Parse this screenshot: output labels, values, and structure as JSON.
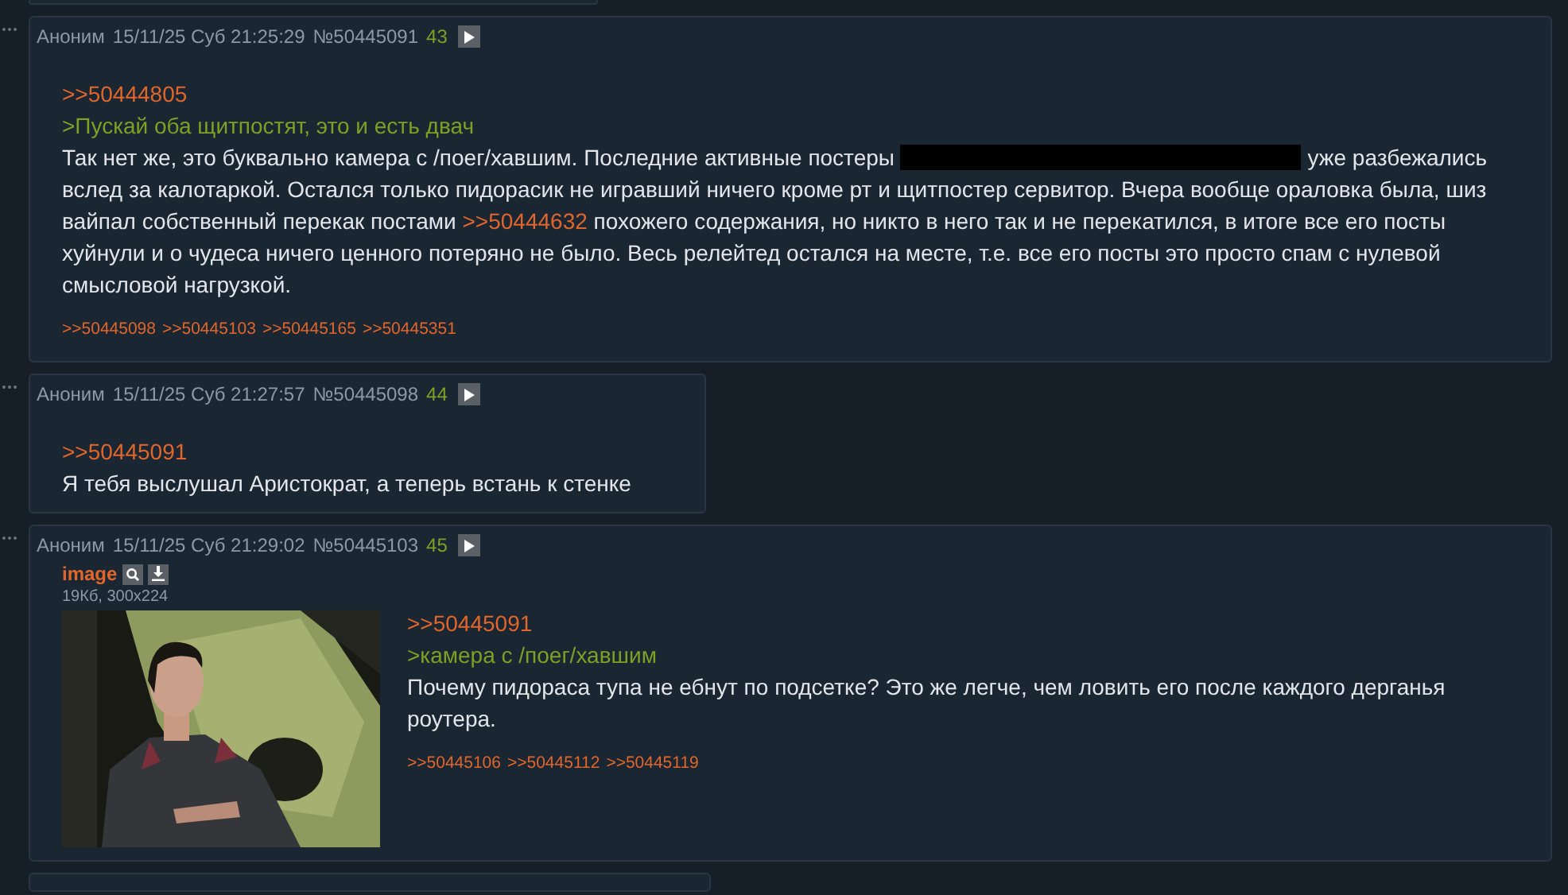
{
  "posts": [
    {
      "author": "Аноним",
      "date": "15/11/25 Суб 21:25:29",
      "number": "№50445091",
      "count": "43",
      "lines": [
        {
          "kind": "reply",
          "text": ">>50444805"
        },
        {
          "kind": "quote",
          "text": ">Пускай оба щитпостят, это и есть двач"
        },
        {
          "kind": "text",
          "segments": [
            {
              "kind": "text",
              "text": "Так нет же, это буквально камера с /поег/хавшим. Последние активные постеры "
            },
            {
              "kind": "redacted"
            },
            {
              "kind": "text",
              "text": " уже разбежались вслед за калотаркой. Остался только пидорасик не игравший ничего кроме рт и щитпостер сервитор. Вчера вообще ораловка была, шиз вайпал собственный перекак постами "
            },
            {
              "kind": "link",
              "text": ">>50444632"
            },
            {
              "kind": "text",
              "text": " похожего содержания, но никто в него так и не перекатился, в итоге все его посты хуйнули и о чудеса ничего ценного потеряно не было. Весь релейтед остался на месте, т.е. все его посты это просто спам с нулевой смысловой нагрузкой."
            }
          ]
        }
      ],
      "backlinks": [
        ">>50445098",
        ">>50445103",
        ">>50445165",
        ">>50445351"
      ]
    },
    {
      "author": "Аноним",
      "date": "15/11/25 Суб 21:27:57",
      "number": "№50445098",
      "count": "44",
      "lines": [
        {
          "kind": "reply",
          "text": ">>50445091"
        },
        {
          "kind": "text",
          "segments": [
            {
              "kind": "text",
              "text": "Я тебя выслушал Аристократ, а теперь встань к стенке"
            }
          ]
        }
      ]
    },
    {
      "author": "Аноним",
      "date": "15/11/25 Суб 21:29:02",
      "number": "№50445103",
      "count": "45",
      "attachment": {
        "name": "image",
        "info": "19Кб, 300x224",
        "kind": "picture"
      },
      "lines": [
        {
          "kind": "reply",
          "text": ">>50445091"
        },
        {
          "kind": "quote",
          "text": ">камера с /поег/хавшим"
        },
        {
          "kind": "text",
          "segments": [
            {
              "kind": "text",
              "text": "Почему пидораса тупа не ебнут по подсетке? Это же легче, чем ловить его после каждого дерганья роутера."
            }
          ]
        }
      ],
      "backlinks": [
        ">>50445106",
        ">>50445112",
        ">>50445119"
      ]
    }
  ]
}
